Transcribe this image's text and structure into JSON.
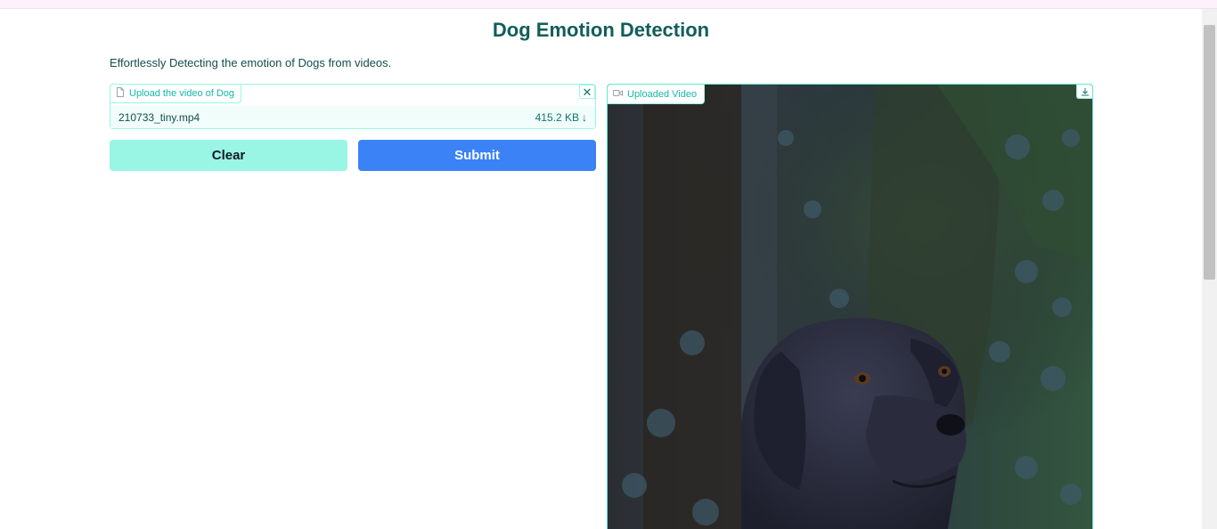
{
  "app": {
    "title": "Dog Emotion Detection",
    "description": "Effortlessly Detecting the emotion of Dogs from videos."
  },
  "upload": {
    "label": "Upload the video of Dog",
    "file_name": "210733_tiny.mp4",
    "file_size": "415.2 KB",
    "close_icon": "close-icon",
    "download_icon": "download-arrow-icon"
  },
  "actions": {
    "clear_label": "Clear",
    "submit_label": "Submit"
  },
  "video": {
    "label": "Uploaded Video",
    "icon": "video-camera-icon",
    "download_icon": "download-icon"
  },
  "colors": {
    "accent": "#14b8a6",
    "title": "#115e59",
    "clear_button": "#99f6e4",
    "submit_button": "#3b82f6"
  }
}
